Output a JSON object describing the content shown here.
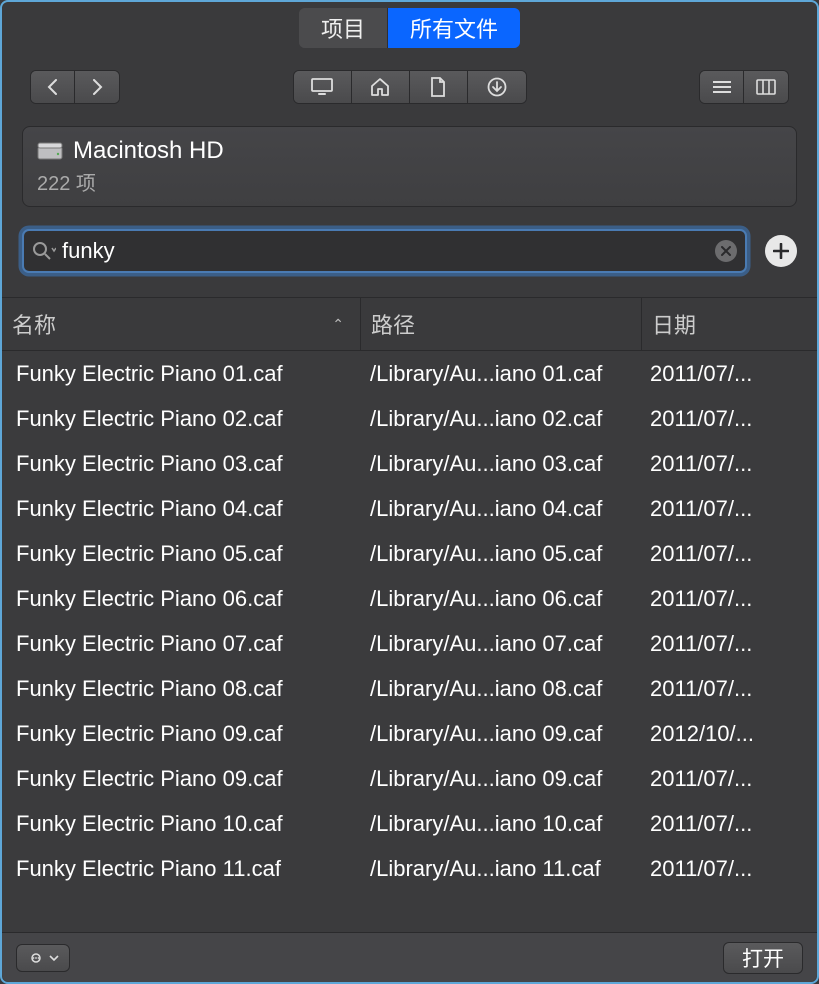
{
  "tabs": {
    "project": "项目",
    "all_files": "所有文件",
    "active": "all_files"
  },
  "location": {
    "title": "Macintosh HD",
    "subtitle": "222 项"
  },
  "search": {
    "value": "funky",
    "placeholder": ""
  },
  "columns": {
    "name": "名称",
    "path": "路径",
    "date": "日期",
    "sort_indicator": "⌃"
  },
  "files": [
    {
      "name": "Funky Electric Piano 01.caf",
      "path": "/Library/Au...iano 01.caf",
      "date": "2011/07/..."
    },
    {
      "name": "Funky Electric Piano 02.caf",
      "path": "/Library/Au...iano 02.caf",
      "date": "2011/07/..."
    },
    {
      "name": "Funky Electric Piano 03.caf",
      "path": "/Library/Au...iano 03.caf",
      "date": "2011/07/..."
    },
    {
      "name": "Funky Electric Piano 04.caf",
      "path": "/Library/Au...iano 04.caf",
      "date": "2011/07/..."
    },
    {
      "name": "Funky Electric Piano 05.caf",
      "path": "/Library/Au...iano 05.caf",
      "date": "2011/07/..."
    },
    {
      "name": "Funky Electric Piano 06.caf",
      "path": "/Library/Au...iano 06.caf",
      "date": "2011/07/..."
    },
    {
      "name": "Funky Electric Piano 07.caf",
      "path": "/Library/Au...iano 07.caf",
      "date": "2011/07/..."
    },
    {
      "name": "Funky Electric Piano 08.caf",
      "path": "/Library/Au...iano 08.caf",
      "date": "2011/07/..."
    },
    {
      "name": "Funky Electric Piano 09.caf",
      "path": "/Library/Au...iano 09.caf",
      "date": "2012/10/..."
    },
    {
      "name": "Funky Electric Piano 09.caf",
      "path": "/Library/Au...iano 09.caf",
      "date": "2011/07/..."
    },
    {
      "name": "Funky Electric Piano 10.caf",
      "path": "/Library/Au...iano 10.caf",
      "date": "2011/07/..."
    },
    {
      "name": "Funky Electric Piano 11.caf",
      "path": "/Library/Au...iano 11.caf",
      "date": "2011/07/..."
    }
  ],
  "footer": {
    "open": "打开"
  }
}
